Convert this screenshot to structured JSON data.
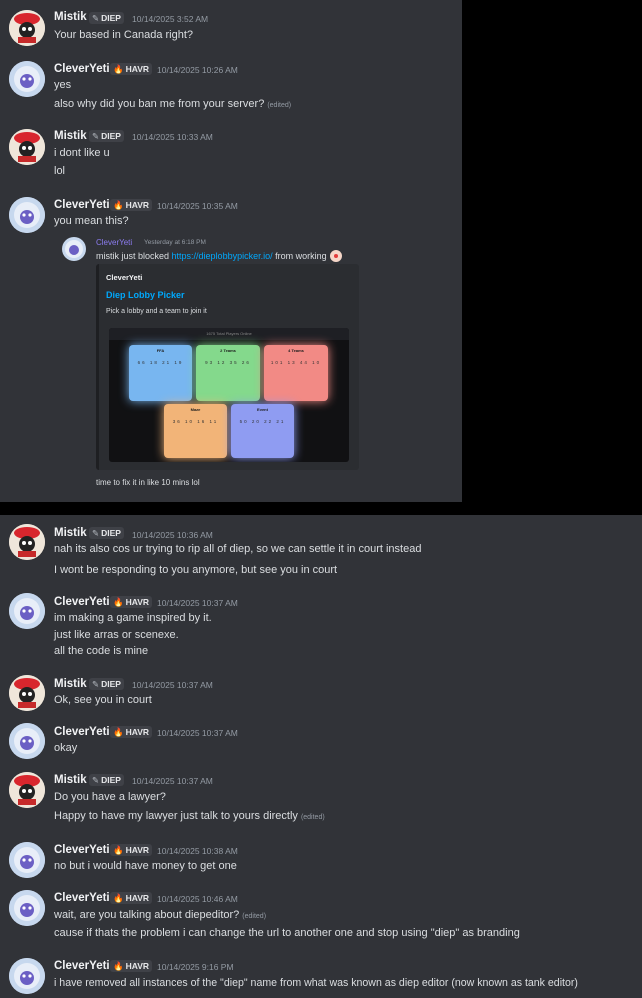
{
  "users": {
    "mistik": {
      "name": "Mistik",
      "tag": "DIEP",
      "tag_icon": "wrench-icon",
      "tag_color": "#b5bac1"
    },
    "clever": {
      "name": "CleverYeti",
      "tag": "HAVR",
      "tag_icon": "flame-icon",
      "tag_color": "#f0a020"
    }
  },
  "messages": [
    {
      "user": "Mistik",
      "tag": "DIEP",
      "time": "10/14/2025 3:52 AM",
      "lines": [
        "Your based in Canada right?"
      ]
    },
    {
      "user": "CleverYeti",
      "tag": "HAVR",
      "time": "10/14/2025 10:26 AM",
      "lines": [
        "yes",
        "also why did you ban me from your server?"
      ],
      "edited": "(edited)"
    },
    {
      "user": "Mistik",
      "tag": "DIEP",
      "time": "10/14/2025 10:33 AM",
      "lines": [
        "i dont like u",
        "lol"
      ]
    },
    {
      "user": "CleverYeti",
      "tag": "HAVR",
      "time": "10/14/2025 10:35 AM",
      "lines": [
        "you mean this?"
      ]
    },
    {
      "user": "Mistik",
      "tag": "DIEP",
      "time": "10/14/2025 10:36 AM",
      "lines": [
        "nah its also cos ur trying to rip all of diep, so we can settle it in court instead",
        "I wont be responding to you anymore, but see you in court"
      ]
    },
    {
      "user": "CleverYeti",
      "tag": "HAVR",
      "time": "10/14/2025 10:37 AM",
      "lines": [
        "im making a game inspired by it.",
        "just like arras or scenexe.",
        "all the code is mine"
      ]
    },
    {
      "user": "Mistik",
      "tag": "DIEP",
      "time": "10/14/2025 10:37 AM",
      "lines": [
        "Ok, see you in court"
      ]
    },
    {
      "user": "CleverYeti",
      "tag": "HAVR",
      "time": "10/14/2025 10:37 AM",
      "lines": [
        "okay"
      ]
    },
    {
      "user": "Mistik",
      "tag": "DIEP",
      "time": "10/14/2025 10:37 AM",
      "lines": [
        "Do you have a lawyer?",
        "Happy to have my lawyer just talk to yours directly"
      ],
      "edited": "(edited)"
    },
    {
      "user": "CleverYeti",
      "tag": "HAVR",
      "time": "10/14/2025 10:38 AM",
      "lines": [
        "no but i would have money to get one"
      ]
    },
    {
      "user": "CleverYeti",
      "tag": "HAVR",
      "time": "10/14/2025 10:46 AM",
      "lines": [
        "wait, are you talking about diepeditor?",
        "cause if thats the problem i can change the url to another one and stop using \"diep\" as branding"
      ],
      "edited": "(edited)"
    },
    {
      "user": "CleverYeti",
      "tag": "HAVR",
      "time": "10/14/2025 9:16 PM",
      "lines": [
        "i have removed all instances of the \"diep\" name from what was known as diep editor (now known as tank editor)"
      ]
    }
  ],
  "forwarded": {
    "user": "CleverYeti",
    "time": "Yesterday at 6:18 PM",
    "text_before": "mistik just blocked ",
    "link": "https://dieplobbypicker.io/",
    "text_after": " from working",
    "emoji": "clown-face-icon",
    "embed": {
      "site": "CleverYeti",
      "title": "Diep Lobby Picker",
      "description": "Pick a lobby and a team to join it",
      "preview": {
        "header_text": "1675 Total Players Online",
        "cards": [
          {
            "label": "FFA",
            "values": "66 18 21 19",
            "color": "#78b6f0"
          },
          {
            "label": "2 Teams",
            "values": "93 12 35 26",
            "color": "#84d98c"
          },
          {
            "label": "4 Teams",
            "values": "101 13 44 10",
            "color": "#f28a85"
          },
          {
            "label": "Maze",
            "values": "36 10 16 11",
            "color": "#f2b478"
          },
          {
            "label": "Event",
            "values": "50 20 22 21",
            "color": "#8f9cf2"
          }
        ]
      }
    },
    "caption": "time to fix it in like 10 mins lol"
  }
}
